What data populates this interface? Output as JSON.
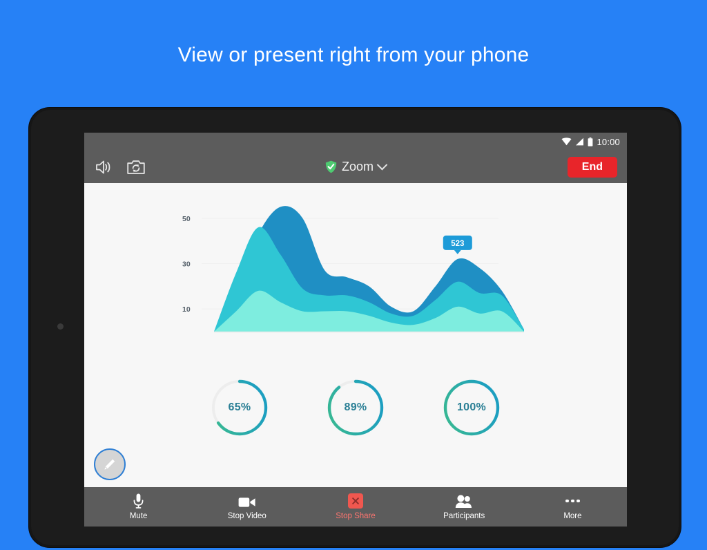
{
  "page": {
    "headline": "View or present right from your phone",
    "background_color": "#2681f6"
  },
  "status_bar": {
    "time": "10:00",
    "icons": [
      "wifi-icon",
      "cellular-signal-icon",
      "battery-icon"
    ]
  },
  "top_bar": {
    "speaker_icon": "speaker-icon",
    "switch_camera_icon": "switch-camera-icon",
    "shield_icon": "shield-check-icon",
    "meeting_title": "Zoom",
    "dropdown_icon": "chevron-down-icon",
    "end_label": "End",
    "end_color": "#e8252a",
    "bar_color": "#5c5c5c",
    "shield_color": "#4ecb71"
  },
  "chart_data": {
    "type": "area",
    "title": "",
    "xlabel": "",
    "ylabel": "",
    "ylim": [
      0,
      60
    ],
    "grid": false,
    "legend": "none",
    "yticks": [
      50,
      30,
      10
    ],
    "ytick_labels": [
      "50",
      "30",
      "10"
    ],
    "annotation": {
      "label": "523",
      "x": 11,
      "value": 32,
      "background": "#1d9bd8",
      "text_color": "#ffffff"
    },
    "x": [
      0,
      1,
      2,
      3,
      4,
      5,
      6,
      7,
      8,
      9,
      10,
      11,
      12,
      13,
      14
    ],
    "series": [
      {
        "name": "series-back",
        "color": "#1f8fc4",
        "values": [
          0,
          18,
          43,
          55,
          50,
          27,
          24,
          20,
          11,
          9,
          20,
          32,
          28,
          18,
          1
        ]
      },
      {
        "name": "series-mid",
        "color": "#2fc6d4",
        "values": [
          0,
          26,
          46,
          34,
          19,
          16,
          16,
          13,
          8,
          7,
          14,
          22,
          17,
          16,
          1
        ]
      },
      {
        "name": "series-front",
        "color": "#7eeddf",
        "values": [
          0,
          9,
          18,
          13,
          9,
          9,
          9,
          7,
          4,
          3,
          6,
          11,
          8,
          9,
          0
        ]
      }
    ]
  },
  "donuts": [
    {
      "name": "donut-65",
      "label": "65%",
      "percent": 65,
      "track_color": "#ededed"
    },
    {
      "name": "donut-89",
      "label": "89%",
      "percent": 89,
      "track_color": "#ededed"
    },
    {
      "name": "donut-100",
      "label": "100%",
      "percent": 100,
      "track_color": "#ededed"
    }
  ],
  "donut_gradient": {
    "from": "#3aba8f",
    "to": "#1d9fc0",
    "text_color": "#2a7f95"
  },
  "annotate_button": {
    "icon": "pencil-icon",
    "ring_color": "#2f7fd4",
    "fill_color": "#d5d5d5"
  },
  "bottom_bar": {
    "items": [
      {
        "name": "mute",
        "label": "Mute",
        "icon": "microphone-icon",
        "danger": false
      },
      {
        "name": "stop-video",
        "label": "Stop Video",
        "icon": "video-camera-icon",
        "danger": false
      },
      {
        "name": "stop-share",
        "label": "Stop Share",
        "icon": "stop-share-x-icon",
        "danger": true
      },
      {
        "name": "participants",
        "label": "Participants",
        "icon": "participants-icon",
        "danger": false
      },
      {
        "name": "more",
        "label": "More",
        "icon": "more-dots-icon",
        "danger": false
      }
    ]
  }
}
